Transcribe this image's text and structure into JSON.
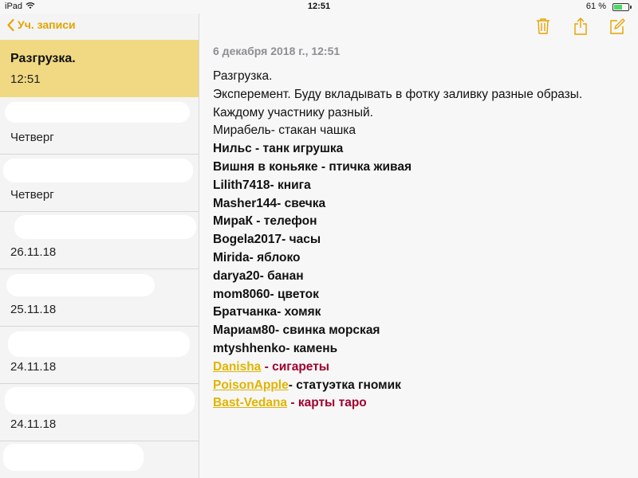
{
  "status_bar": {
    "device": "iPad",
    "time": "12:51",
    "battery": "61 %",
    "battery_level": 0.61
  },
  "sidebar": {
    "back_label": "Уч. записи",
    "items": [
      {
        "title": "Разгрузка.",
        "date": "12:51"
      },
      {
        "title": "",
        "date": "Четверг"
      },
      {
        "title": "",
        "date": "Четверг"
      },
      {
        "title": "",
        "date": "26.11.18"
      },
      {
        "title": "",
        "date": "25.11.18"
      },
      {
        "title": "",
        "date": "24.11.18"
      },
      {
        "title": "",
        "date": "24.11.18"
      }
    ]
  },
  "toolbar": {
    "icons": [
      "trash-icon",
      "share-icon",
      "compose-icon"
    ],
    "accent": "#e5a400"
  },
  "note": {
    "timestamp": "6 декабря 2018 г., 12:51",
    "heading": "Разгрузка.",
    "intro": "Эксперемент. Буду вкладывать в фотку заливку разные образы. Каждому участнику разный.",
    "entries": [
      {
        "nick": "Мирабель",
        "sep": "- ",
        "gift": "стакан чашка"
      },
      {
        "nick": "Нильс",
        "sep": " - ",
        "gift": "танк игрушка"
      },
      {
        "nick": "Вишня в коньяке",
        "sep": " - ",
        "gift": "птичка живая"
      },
      {
        "nick": "Lilith7418",
        "sep": "- ",
        "gift": "книга"
      },
      {
        "nick": "Masher144",
        "sep": "- ",
        "gift": "свечка"
      },
      {
        "nick": "МираК",
        "sep": " - ",
        "gift": "телефон"
      },
      {
        "nick": "Bogela2017",
        "sep": "- ",
        "gift": "часы"
      },
      {
        "nick": "Mirida",
        "sep": "- ",
        "gift": "яблоко"
      },
      {
        "nick": "darya20",
        "sep": "- ",
        "gift": "банан"
      },
      {
        "nick": "mom8060",
        "sep": "- ",
        "gift": "цветок"
      },
      {
        "nick": "Братчанка",
        "sep": "- ",
        "gift": "хомяк"
      },
      {
        "nick": "Мариам80",
        "sep": "- ",
        "gift": "свинка морская"
      },
      {
        "nick": "mtyshhenko",
        "sep": "- ",
        "gift": "камень"
      },
      {
        "nick": "Danisha",
        "sep": " - ",
        "gift": "сигареты"
      },
      {
        "nick": "PoisonApple",
        "sep": "- ",
        "gift": "статуэтка гномик"
      },
      {
        "nick": "Bast-Vedana",
        "sep": " - ",
        "gift": "карты таро"
      }
    ],
    "colors": {
      "nick_highlight": "#e0b400",
      "gift_highlight": "#a0002e"
    }
  }
}
